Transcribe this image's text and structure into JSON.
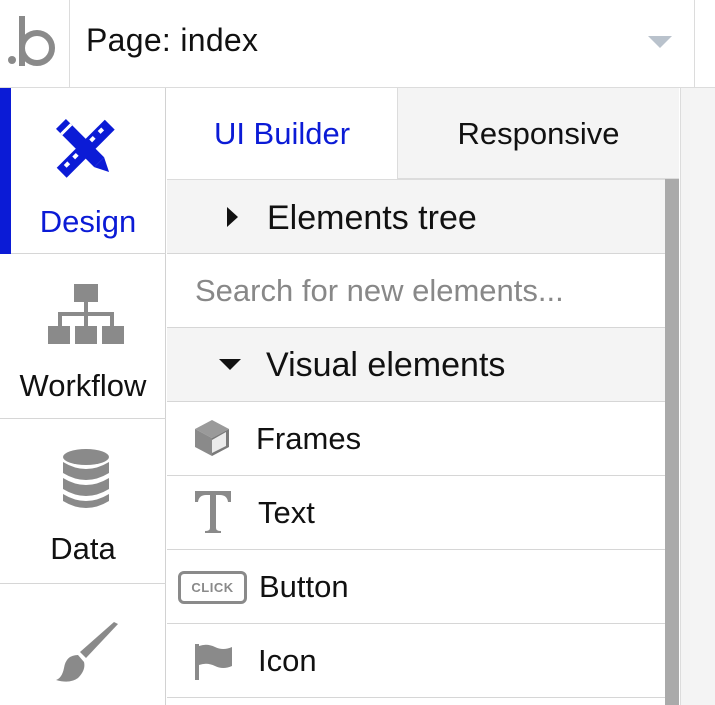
{
  "topbar": {
    "logo_icon": "bubble-logo-icon",
    "page_selector": "Page: index",
    "dropdown_icon": "chevron-down-icon"
  },
  "leftnav": {
    "items": [
      {
        "label": "Design",
        "icon": "design-pencil-ruler-icon",
        "active": true
      },
      {
        "label": "Workflow",
        "icon": "workflow-hierarchy-icon",
        "active": false
      },
      {
        "label": "Data",
        "icon": "database-icon",
        "active": false
      },
      {
        "label": "",
        "icon": "paint-brush-icon",
        "active": false
      }
    ]
  },
  "panel": {
    "tabs": [
      {
        "label": "UI Builder",
        "active": true
      },
      {
        "label": "Responsive",
        "active": false
      }
    ],
    "elements_tree": "Elements tree",
    "search_placeholder": "Search for new elements...",
    "visual_elements": "Visual elements",
    "elements": [
      {
        "label": "Frames",
        "icon": "cube-icon"
      },
      {
        "label": "Text",
        "icon": "text-t-icon"
      },
      {
        "label": "Button",
        "icon": "click-button-icon",
        "icon_text": "CLICK"
      },
      {
        "label": "Icon",
        "icon": "flag-icon"
      }
    ]
  },
  "colors": {
    "accent": "#0b1bd6",
    "icon_gray": "#8a8a8a",
    "section_bg": "#f4f4f4",
    "scrollbar": "#aaaaaa"
  }
}
